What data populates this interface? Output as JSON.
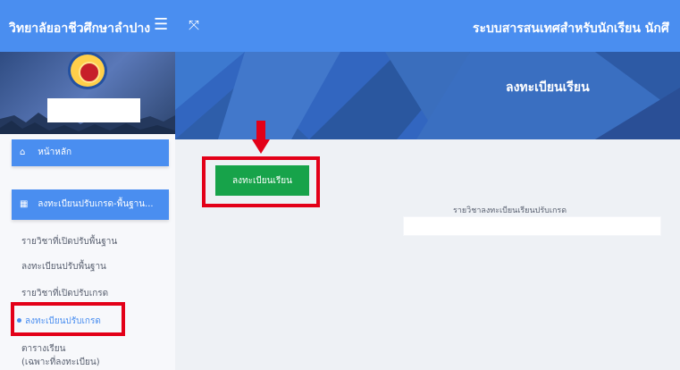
{
  "header": {
    "college_name": "วิทยาลัยอาชีวศึกษาลำปาง",
    "menu_icon": "☰",
    "expand_icon": "⤧",
    "system_title": "ระบบสารสนเทศสำหรับนักเรียน นักศึ"
  },
  "sidebar": {
    "home_label": "หน้าหลัก",
    "home_icon": "⌂",
    "group_label": "ลงทะเบียนปรับเกรด-พื้นฐาน...",
    "group_icon": "▦",
    "items": [
      "รายวิชาที่เปิดปรับพื้นฐาน",
      "ลงทะเบียนปรับพื้นฐาน",
      "รายวิชาที่เปิดปรับเกรด",
      "ลงทะเบียนปรับเกรด"
    ],
    "timetable_line1": "ตารางเรียน",
    "timetable_line2": "(เฉพาะที่ลงทะเบียน)"
  },
  "main": {
    "banner_title": "ลงทะเบียนเรียน",
    "register_button": "ลงทะเบียนเรียน",
    "section_label": "รายวิชาลงทะเบียนเรียนปรับเกรด"
  },
  "colors": {
    "primary": "#4a8ef0",
    "highlight": "#e30018",
    "success": "#17a34a"
  }
}
